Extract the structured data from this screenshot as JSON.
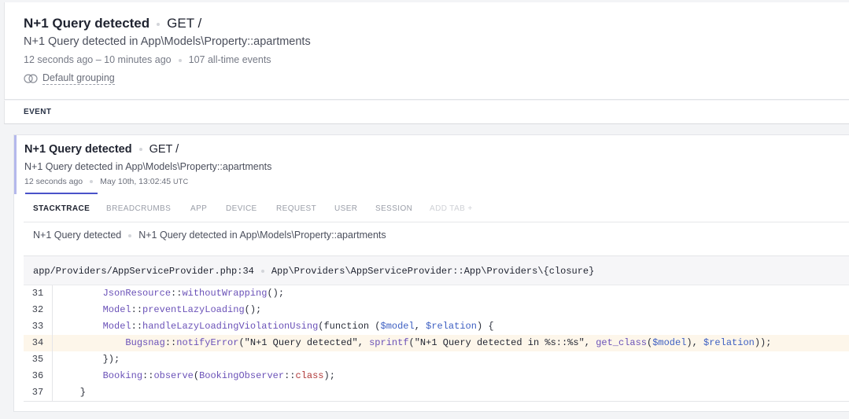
{
  "header": {
    "title": "N+1 Query detected",
    "method": "GET /",
    "subtitle": "N+1 Query detected in App\\Models\\Property::apartments",
    "time_range": "12 seconds ago – 10 minutes ago",
    "event_count": "107 all-time events",
    "grouping_label": "Default grouping",
    "grouping_icon": "grouping-icon"
  },
  "event_bar": {
    "label": "EVENT"
  },
  "event": {
    "title": "N+1 Query detected",
    "method": "GET /",
    "subtitle": "N+1 Query detected in App\\Models\\Property::apartments",
    "relative_time": "12 seconds ago",
    "timestamp": "May 10th, 13:02:45",
    "tz": "UTC"
  },
  "tabs": [
    {
      "label": "STACKTRACE",
      "active": true
    },
    {
      "label": "BREADCRUMBS",
      "active": false
    },
    {
      "label": "APP",
      "active": false
    },
    {
      "label": "DEVICE",
      "active": false
    },
    {
      "label": "REQUEST",
      "active": false
    },
    {
      "label": "USER",
      "active": false
    },
    {
      "label": "SESSION",
      "active": false
    },
    {
      "label": "ADD TAB +",
      "active": false
    }
  ],
  "stacktrace": {
    "error_class": "N+1 Query detected",
    "error_message": "N+1 Query detected in App\\Models\\Property::apartments",
    "frame_file": "app/Providers/AppServiceProvider.php:34",
    "frame_method": "App\\Providers\\AppServiceProvider::App\\Providers\\{closure}",
    "highlight_line": 34,
    "line_numbers": [
      "31",
      "32",
      "33",
      "34",
      "35",
      "36",
      "37"
    ]
  },
  "colors": {
    "accent": "#4a52c9",
    "event_border": "#b4b8ec",
    "highlight_bg": "#fdf6ea",
    "code_class": "#6b52b8",
    "code_variable": "#3d5fc2",
    "code_keyword": "#b03a3a"
  }
}
